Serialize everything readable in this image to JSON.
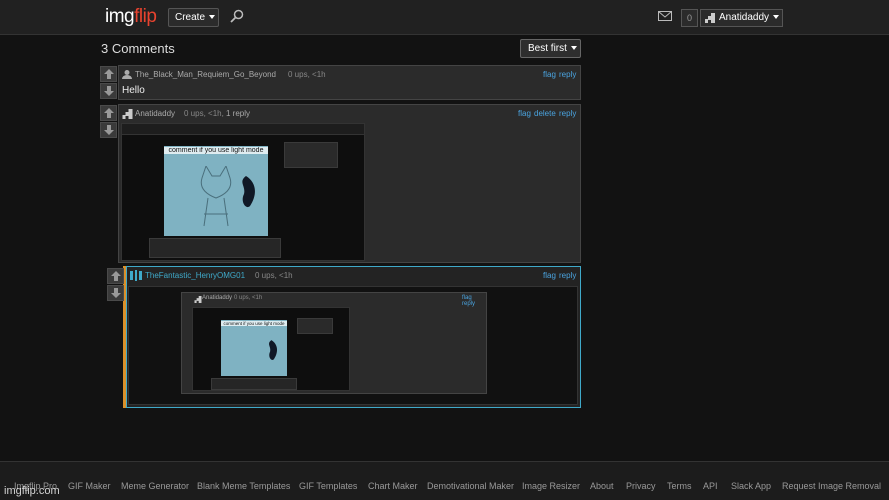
{
  "header": {
    "logo_img": "img",
    "logo_flip": "flip",
    "create_label": "Create",
    "notif_count": "0",
    "username": "Anatidaddy"
  },
  "comments_header": {
    "title": "3 Comments",
    "sort_label": "Best first"
  },
  "comments": [
    {
      "user": "The_Black_Man_Requiem_Go_Beyond",
      "meta": "0 ups, <1h",
      "actions": [
        "flag",
        "reply"
      ],
      "text": "Hello"
    },
    {
      "user": "Anatidaddy",
      "meta": "0 ups, <1h,",
      "replies": "1 reply",
      "actions": [
        "flag",
        "delete",
        "reply"
      ],
      "image_caption": "comment if you use light mode"
    },
    {
      "user": "TheFantastic_HenryOMG01",
      "meta": "0 ups, <1h",
      "actions": [
        "flag",
        "reply"
      ],
      "nested_user": "Anatidaddy",
      "nested_meta": "0 ups, <1h",
      "nested_action": "flag reply",
      "image_caption": "comment if you use light mode"
    }
  ],
  "footer": {
    "links": [
      "Imgflip Pro",
      "GIF Maker",
      "Meme Generator",
      "Blank Meme Templates",
      "GIF Templates",
      "Chart Maker",
      "Demotivational Maker",
      "Image Resizer",
      "About",
      "Privacy",
      "Terms",
      "API",
      "Slack App",
      "Request Image Removal"
    ],
    "watermark": "imgflip.com"
  },
  "colors": {
    "accent_link": "#4aa3df",
    "logo_flip": "#e8432f",
    "highlight_border": "#3fa9c9",
    "reply_bar": "#d9902a"
  }
}
